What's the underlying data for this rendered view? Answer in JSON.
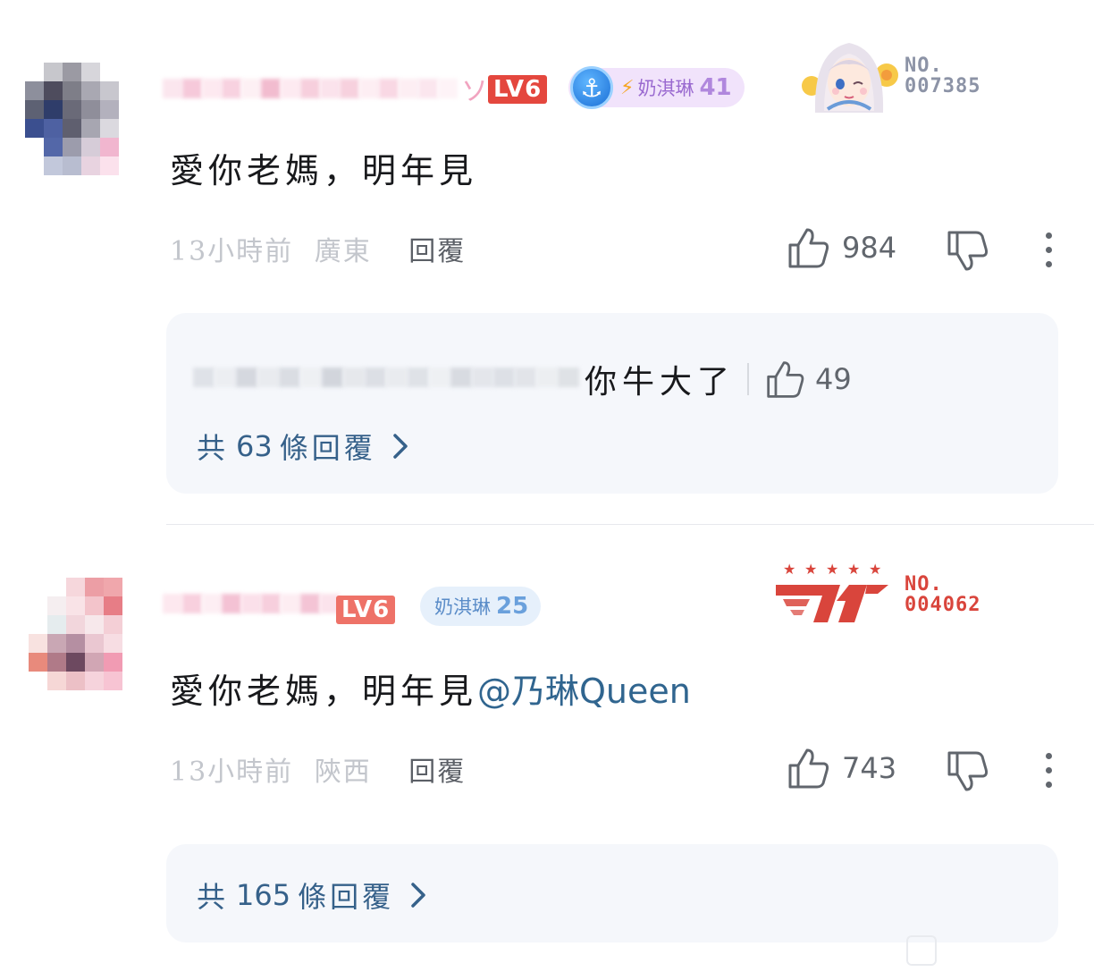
{
  "comments": [
    {
      "level": "LV6",
      "username_tail": "ソ",
      "fan_badge": {
        "name": "奶淇琳",
        "level": "41"
      },
      "decoration_no": "NO.\n007385",
      "content": "愛你老媽，明年見",
      "mention": "",
      "time": "13小時前",
      "location": "廣東",
      "reply_label": "回覆",
      "like_count": "984",
      "sub_reply": {
        "text": "你牛大了",
        "like_count": "49"
      },
      "total_replies": {
        "prefix": "共",
        "count": "63",
        "suffix": "條回覆"
      }
    },
    {
      "level": "LV6",
      "fan_badge": {
        "name": "奶淇琳",
        "level": "25"
      },
      "decoration_no": "NO.\n004062",
      "decoration_logo": "T1",
      "content": "愛你老媽，明年見",
      "mention": "@乃琳Queen",
      "time": "13小時前",
      "location": "陝西",
      "reply_label": "回覆",
      "like_count": "743",
      "total_replies": {
        "prefix": "共",
        "count": "165",
        "suffix": "條回覆"
      }
    }
  ],
  "icons": {
    "like": "thumbs-up-icon",
    "dislike": "thumbs-down-icon",
    "more": "more-vertical-icon",
    "arrow": "chevron-right-icon",
    "anchor": "anchor-icon"
  },
  "colors": {
    "level_badge": "#e4473e",
    "link": "#36618a",
    "reply_box_bg": "#f5f7fb",
    "meta_text": "#c3c6cc"
  }
}
